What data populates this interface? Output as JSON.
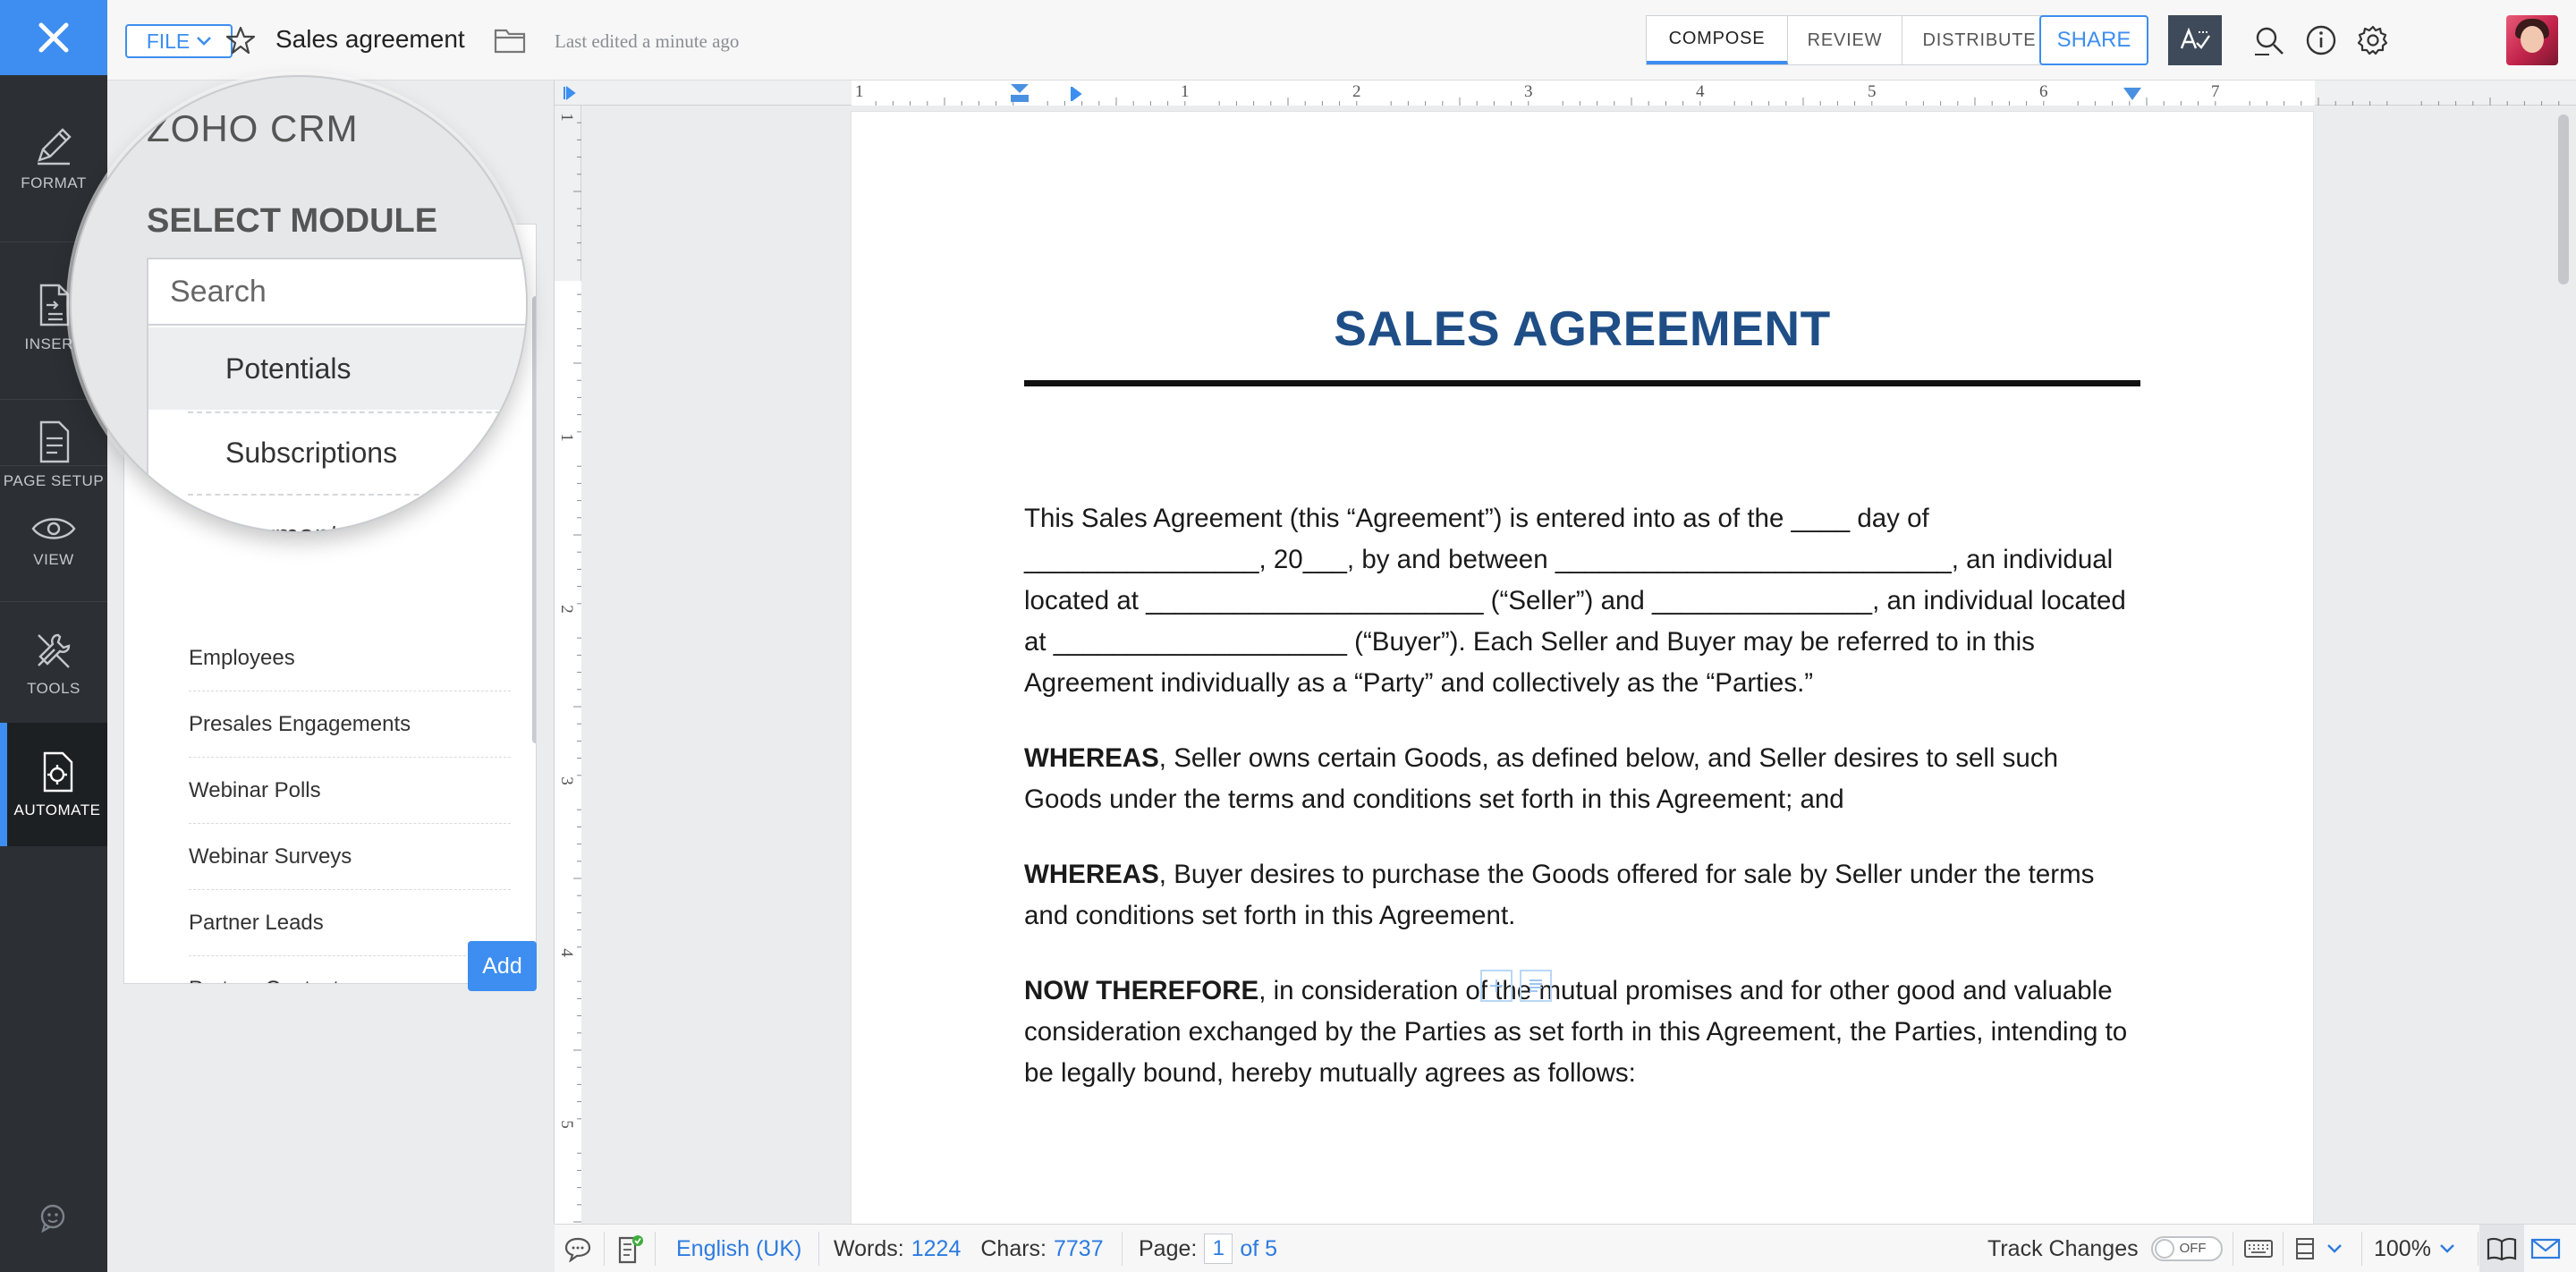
{
  "rail": {
    "close_icon": "close-icon",
    "items": [
      {
        "label": "FORMAT",
        "icon": "pen-icon"
      },
      {
        "label": "INSERT",
        "icon": "insert-document-icon"
      },
      {
        "label": "PAGE SETUP",
        "icon": "page-setup-icon"
      },
      {
        "label": "VIEW",
        "icon": "eye-icon"
      },
      {
        "label": "TOOLS",
        "icon": "tools-icon"
      },
      {
        "label": "AUTOMATE",
        "icon": "automate-icon"
      }
    ],
    "feedback_icon": "feedback-icon"
  },
  "topbar": {
    "file_label": "FILE",
    "doc_title": "Sales agreement",
    "last_edited": "Last edited a minute ago",
    "mode_tabs": [
      {
        "label": "COMPOSE",
        "active": true
      },
      {
        "label": "REVIEW",
        "active": false
      },
      {
        "label": "DISTRIBUTE",
        "active": false
      }
    ],
    "share_label": "SHARE",
    "accent_color": "#3d8ef0"
  },
  "panel": {
    "brand": "ZOHO CRM",
    "heading": "SELECT MODULE",
    "search_placeholder": "Search",
    "magnified_items": [
      "Potentials",
      "Subscriptions",
      "Payments"
    ],
    "items": [
      "Employees",
      "Presales Engagements",
      "Webinar Polls",
      "Webinar Surveys",
      "Partner Leads",
      "Partner Contacts"
    ],
    "add_label": "Add"
  },
  "ruler": {
    "top_numbers": [
      "1",
      "1",
      "2",
      "3",
      "4",
      "5",
      "6",
      "7"
    ],
    "left_numbers": [
      "1",
      "1",
      "2",
      "3",
      "4",
      "5"
    ]
  },
  "document": {
    "heading": "SALES AGREEMENT",
    "heading_color": "#1f4e87",
    "para1": "This Sales Agreement (this “Agreement”) is entered into as of the ____ day of ________________, 20___, by and between ___________________________, an individual located at _______________________ (“Seller”) and _______________, an individual located at ____________________ (“Buyer”). Each Seller and Buyer may be referred to in this Agreement individually as a “Party” and collectively as the “Parties.”",
    "para2_bold": "WHEREAS",
    "para2": ", Seller owns certain Goods, as defined below, and Seller desires to sell such Goods under the terms and conditions set forth in this Agreement; and",
    "para3_bold": "WHEREAS",
    "para3": ", Buyer desires to purchase the Goods offered for sale by Seller under the terms and conditions set forth in this Agreement.",
    "para4_bold": "NOW THEREFORE",
    "para4": ", in consideration of the mutual promises and for other good and valuable consideration exchanged by the Parties as set forth in this Agreement, the Parties, intending to be legally bound, hereby mutually agrees as follows:"
  },
  "status": {
    "language": "English (UK)",
    "words_label": "Words:",
    "words": "1224",
    "chars_label": "Chars:",
    "chars": "7737",
    "page_label": "Page:",
    "page_current": "1",
    "page_total": "of 5",
    "track_changes": "Track Changes",
    "toggle_state": "OFF",
    "zoom": "100%"
  }
}
